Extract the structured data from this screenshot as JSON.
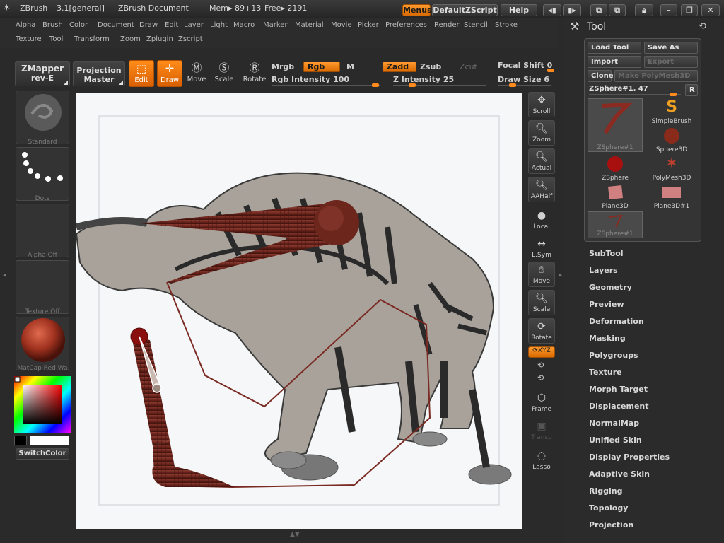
{
  "titlebar": {
    "app": "ZBrush",
    "version": "3.1[general]",
    "document": "ZBrush Document",
    "mem": "Mem▸ 89+13",
    "free": "Free▸ 2191",
    "menus_label": "Menus",
    "script_label": "DefaultZScript",
    "help_label": "Help"
  },
  "menu": {
    "row1": [
      "Alpha",
      "Brush",
      "Color",
      "Document",
      "Draw",
      "Edit",
      "Layer",
      "Light",
      "Macro",
      "Marker",
      "Material",
      "Movie",
      "Picker",
      "Preferences",
      "Render",
      "Stencil",
      "Stroke"
    ],
    "row2": [
      "Texture",
      "Tool",
      "Transform",
      "Zoom",
      "Zplugin",
      "Zscript"
    ]
  },
  "shelf": {
    "zmapper": "ZMapper",
    "zmapper_sub": "rev-E",
    "projection": "Projection",
    "projection_sub": "Master",
    "tools": [
      {
        "label": "Edit",
        "icon": "edit-frame-icon",
        "active": true
      },
      {
        "label": "Draw",
        "icon": "draw-target-icon",
        "active": true
      },
      {
        "label": "Move",
        "icon": "move-m-icon",
        "active": false
      },
      {
        "label": "Scale",
        "icon": "scale-s-icon",
        "active": false
      },
      {
        "label": "Rotate",
        "icon": "rotate-r-icon",
        "active": false
      }
    ],
    "mrgb": "Mrgb",
    "rgb": "Rgb",
    "m": "M",
    "rgb_intensity": "Rgb Intensity 100",
    "zadd": "Zadd",
    "zsub": "Zsub",
    "zcut": "Zcut",
    "z_intensity": "Z Intensity 25",
    "focal_shift": "Focal Shift 0",
    "draw_size": "Draw Size 6",
    "rgb_intensity_value": 100,
    "z_intensity_value": 25,
    "focal_shift_value": 0
  },
  "left_panel": {
    "brush": "Standard",
    "stroke": "Dots",
    "alpha": "Alpha Off",
    "texture": "Texture Off",
    "material": "MatCap Red Wa",
    "switch_color": "SwitchColor"
  },
  "vtools": [
    {
      "label": "Scroll",
      "icon": "scroll-icon"
    },
    {
      "label": "Zoom",
      "icon": "zoom-icon"
    },
    {
      "label": "Actual",
      "icon": "actual-size-icon"
    },
    {
      "label": "AAHalf",
      "icon": "aahalf-icon"
    },
    {
      "label": "Local",
      "icon": "local-icon"
    },
    {
      "label": "L.Sym",
      "icon": "lsym-icon"
    },
    {
      "label": "Move",
      "icon": "move-hand-icon"
    },
    {
      "label": "Scale",
      "icon": "scale-icon"
    },
    {
      "label": "Rotate",
      "icon": "rotate-icon"
    },
    {
      "label": "XYZ",
      "icon": "xyz-icon"
    },
    {
      "label": "Frame",
      "icon": "frame-cube-icon"
    },
    {
      "label": "Transp",
      "icon": "transp-icon"
    },
    {
      "label": "Lasso",
      "icon": "lasso-icon"
    }
  ],
  "tool_panel": {
    "title": "Tool",
    "load_tool": "Load Tool",
    "save_as": "Save As",
    "import": "Import",
    "export": "Export",
    "clone": "Clone",
    "make_polymesh": "Make PolyMesh3D",
    "current_tool": "ZSphere#1. 47",
    "r_button": "R",
    "thumbs": [
      "ZSphere#1",
      "SimpleBrush",
      "ZSphere#1",
      "Sphere3D",
      "ZSphere",
      "PolyMesh3D",
      "Plane3D",
      "Plane3D#1",
      "ZSphere#1"
    ],
    "subpalettes": [
      "SubTool",
      "Layers",
      "Geometry",
      "Preview",
      "Deformation",
      "Masking",
      "Polygroups",
      "Texture",
      "Morph Target",
      "Displacement",
      "NormalMap",
      "Unified Skin",
      "Display Properties",
      "Adaptive Skin",
      "Rigging",
      "Topology",
      "Projection"
    ]
  },
  "colors": {
    "accent": "#ff8c1a",
    "zsphere_red": "#7a2a22",
    "panel_bg": "#2b2b2b"
  }
}
